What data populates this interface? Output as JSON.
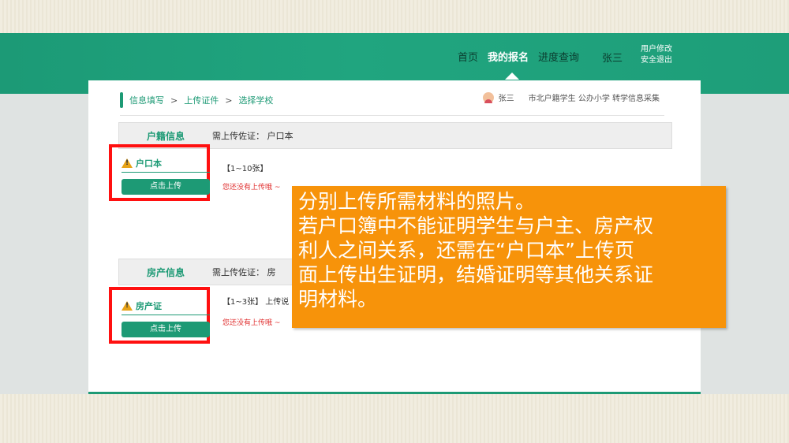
{
  "nav": {
    "items": [
      "首页",
      "我的报名",
      "进度查询"
    ],
    "active": "我的报名",
    "user": "张三",
    "links": [
      "用户修改",
      "安全退出"
    ]
  },
  "breadcrumb": [
    "信息填写",
    "上传证件",
    "选择学校"
  ],
  "user_info": {
    "name": "张三",
    "description": "市北户籍学生 公办小学 转学信息采集"
  },
  "sections": [
    {
      "title": "户籍信息",
      "requirement": "需上传佐证：  户口本",
      "doc_name": "户口本",
      "button": "点击上传",
      "count": "【1~10张】",
      "status": "您还没有上传哦 ~"
    },
    {
      "title": "房产信息",
      "requirement": "需上传佐证：  房",
      "doc_name": "房产证",
      "button": "点击上传",
      "count": "【1~3张】 上传说",
      "status": "您还没有上传哦 ~"
    }
  ],
  "callout": {
    "lines": [
      "分别上传所需材料的照片。",
      "若户口簿中不能证明学生与户主、房产权",
      "利人之间关系，还需在“户口本”上传页",
      "面上传出生证明，结婚证明等其他关系证",
      "明材料。"
    ]
  },
  "colors": {
    "brand_green": "#1d9a75",
    "highlight_red": "#ff1010",
    "callout_orange": "#f7930a"
  }
}
